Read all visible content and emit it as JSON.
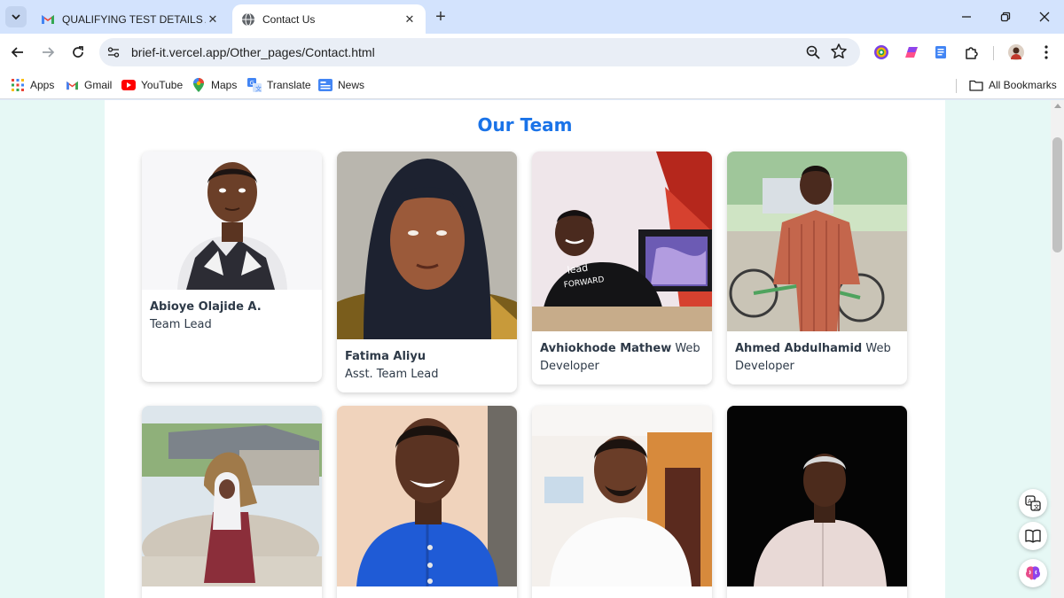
{
  "browser": {
    "tabs": [
      {
        "title": "QUALIFYING TEST DETAILS AND",
        "favicon": "gmail-icon",
        "active": false
      },
      {
        "title": "Contact Us",
        "favicon": "globe-icon",
        "active": true
      }
    ],
    "url": "brief-it.vercel.app/Other_pages/Contact.html",
    "bookmarks": [
      {
        "label": "Apps",
        "icon": "apps-grid-icon"
      },
      {
        "label": "Gmail",
        "icon": "gmail-icon"
      },
      {
        "label": "YouTube",
        "icon": "youtube-icon"
      },
      {
        "label": "Maps",
        "icon": "maps-icon"
      },
      {
        "label": "Translate",
        "icon": "translate-icon"
      },
      {
        "label": "News",
        "icon": "news-icon"
      }
    ],
    "all_bookmarks_label": "All Bookmarks"
  },
  "team": {
    "title": "Our Team",
    "members": [
      {
        "name": "Abioye Olajide A.",
        "role": "Team Lead"
      },
      {
        "name": "Fatima Aliyu",
        "role": "Asst. Team Lead"
      },
      {
        "name": "Avhiokhode Mathew",
        "role": "Web Developer"
      },
      {
        "name": "Ahmed Abdulhamid",
        "role": "Web Developer"
      }
    ]
  },
  "colors": {
    "accent": "#1a73e8",
    "page_background": "#e6f8f5",
    "text": "#2e3a48"
  }
}
